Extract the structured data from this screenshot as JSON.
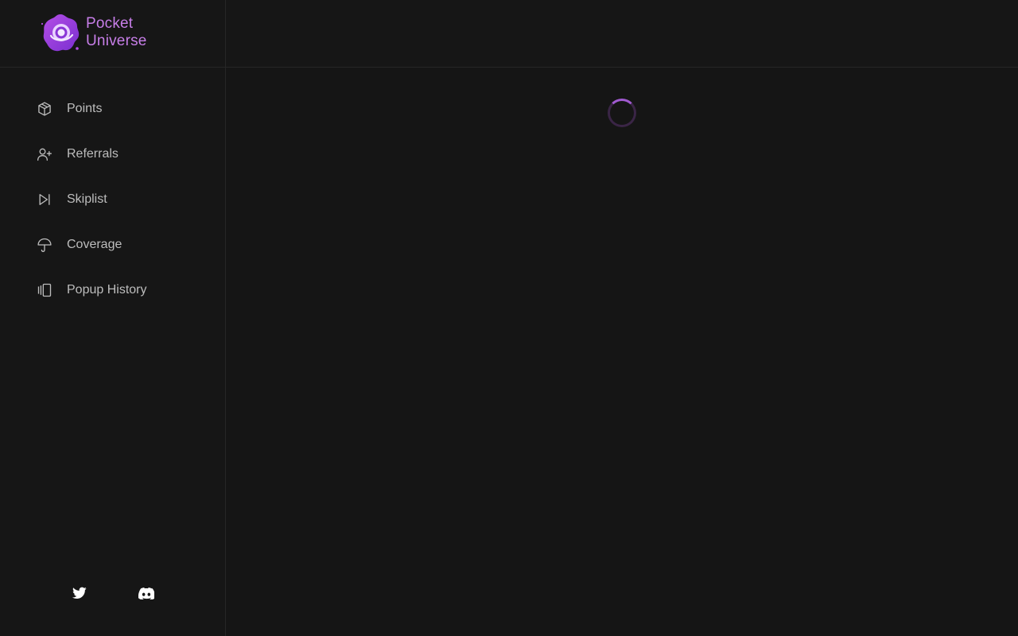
{
  "app": {
    "brand_line1": "Pocket",
    "brand_line2": "Universe",
    "accent_color": "#c77ee8"
  },
  "sidebar": {
    "items": [
      {
        "label": "Points",
        "icon": "cube-icon"
      },
      {
        "label": "Referrals",
        "icon": "user-plus-icon"
      },
      {
        "label": "Skiplist",
        "icon": "skip-forward-icon"
      },
      {
        "label": "Coverage",
        "icon": "umbrella-icon"
      },
      {
        "label": "Popup History",
        "icon": "gallery-icon"
      }
    ],
    "social": [
      {
        "icon": "twitter-icon"
      },
      {
        "icon": "discord-icon"
      }
    ]
  },
  "main": {
    "status": "loading",
    "spinner_icon": "loading-spinner-icon"
  }
}
